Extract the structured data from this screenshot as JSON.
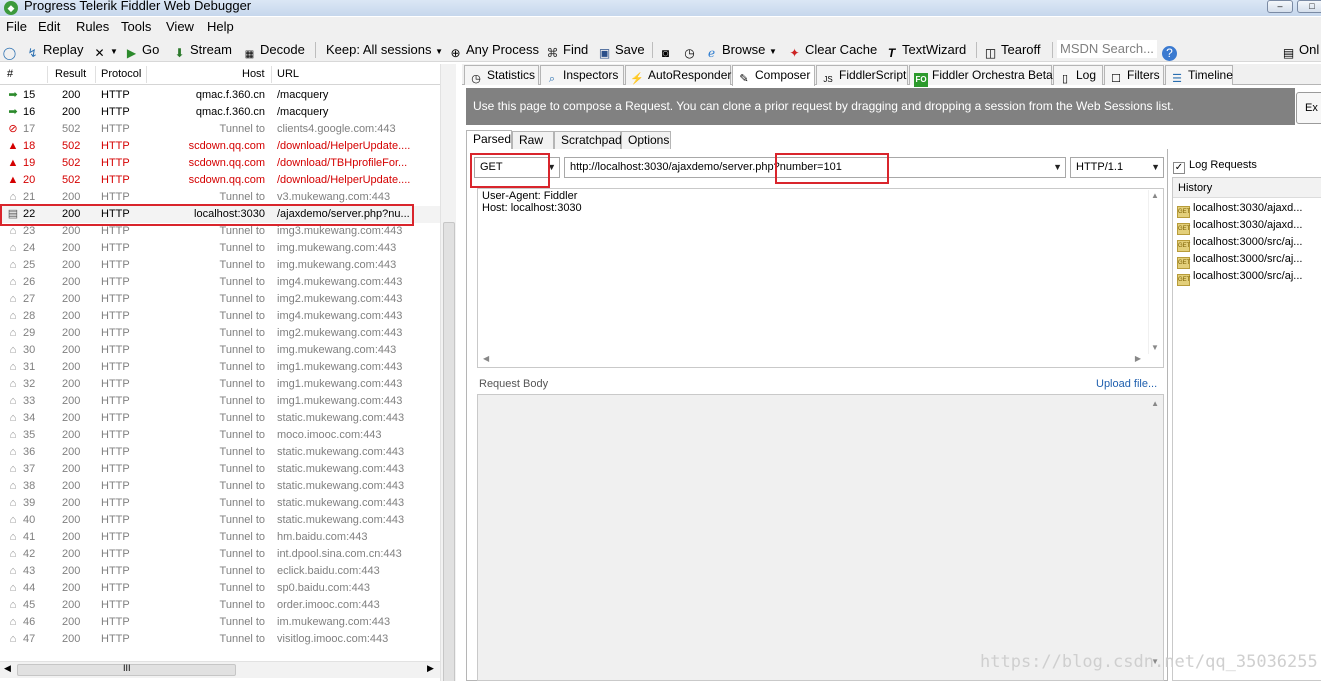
{
  "window": {
    "title": "Progress Telerik Fiddler Web Debugger"
  },
  "menu": [
    "File",
    "Edit",
    "Rules",
    "Tools",
    "View",
    "Help"
  ],
  "toolbar": {
    "replay": "Replay",
    "go": "Go",
    "stream": "Stream",
    "decode": "Decode",
    "keep": "Keep: All sessions",
    "any_process": "Any Process",
    "find": "Find",
    "save": "Save",
    "browse": "Browse",
    "clear_cache": "Clear Cache",
    "textwizard": "TextWizard",
    "tearoff": "Tearoff",
    "msdn_search": "MSDN Search...",
    "online": "Onl"
  },
  "sessions": {
    "columns": {
      "num": "#",
      "result": "Result",
      "protocol": "Protocol",
      "host": "Host",
      "url": "URL"
    },
    "rows": [
      {
        "num": "15",
        "result": "200",
        "protocol": "HTTP",
        "host": "qmac.f.360.cn",
        "url": "/macquery",
        "icon": "arrow-right-icon"
      },
      {
        "num": "16",
        "result": "200",
        "protocol": "HTTP",
        "host": "qmac.f.360.cn",
        "url": "/macquery",
        "icon": "arrow-right-icon"
      },
      {
        "num": "17",
        "result": "502",
        "protocol": "HTTP",
        "host": "Tunnel to",
        "url": "clients4.google.com:443",
        "icon": "blocked-icon"
      },
      {
        "num": "18",
        "result": "502",
        "protocol": "HTTP",
        "host": "scdown.qq.com",
        "url": "/download/HelperUpdate....",
        "icon": "warning-icon"
      },
      {
        "num": "19",
        "result": "502",
        "protocol": "HTTP",
        "host": "scdown.qq.com",
        "url": "/download/TBHprofileFor...",
        "icon": "warning-icon"
      },
      {
        "num": "20",
        "result": "502",
        "protocol": "HTTP",
        "host": "scdown.qq.com",
        "url": "/download/HelperUpdate....",
        "icon": "warning-icon"
      },
      {
        "num": "21",
        "result": "200",
        "protocol": "HTTP",
        "host": "Tunnel to",
        "url": "v3.mukewang.com:443",
        "icon": "lock-icon"
      },
      {
        "num": "22",
        "result": "200",
        "protocol": "HTTP",
        "host": "localhost:3030",
        "url": "/ajaxdemo/server.php?nu...",
        "icon": "document-icon"
      },
      {
        "num": "23",
        "result": "200",
        "protocol": "HTTP",
        "host": "Tunnel to",
        "url": "img3.mukewang.com:443",
        "icon": "lock-icon"
      },
      {
        "num": "24",
        "result": "200",
        "protocol": "HTTP",
        "host": "Tunnel to",
        "url": "img.mukewang.com:443",
        "icon": "lock-icon"
      },
      {
        "num": "25",
        "result": "200",
        "protocol": "HTTP",
        "host": "Tunnel to",
        "url": "img.mukewang.com:443",
        "icon": "lock-icon"
      },
      {
        "num": "26",
        "result": "200",
        "protocol": "HTTP",
        "host": "Tunnel to",
        "url": "img4.mukewang.com:443",
        "icon": "lock-icon"
      },
      {
        "num": "27",
        "result": "200",
        "protocol": "HTTP",
        "host": "Tunnel to",
        "url": "img2.mukewang.com:443",
        "icon": "lock-icon"
      },
      {
        "num": "28",
        "result": "200",
        "protocol": "HTTP",
        "host": "Tunnel to",
        "url": "img4.mukewang.com:443",
        "icon": "lock-icon"
      },
      {
        "num": "29",
        "result": "200",
        "protocol": "HTTP",
        "host": "Tunnel to",
        "url": "img2.mukewang.com:443",
        "icon": "lock-icon"
      },
      {
        "num": "30",
        "result": "200",
        "protocol": "HTTP",
        "host": "Tunnel to",
        "url": "img.mukewang.com:443",
        "icon": "lock-icon"
      },
      {
        "num": "31",
        "result": "200",
        "protocol": "HTTP",
        "host": "Tunnel to",
        "url": "img1.mukewang.com:443",
        "icon": "lock-icon"
      },
      {
        "num": "32",
        "result": "200",
        "protocol": "HTTP",
        "host": "Tunnel to",
        "url": "img1.mukewang.com:443",
        "icon": "lock-icon"
      },
      {
        "num": "33",
        "result": "200",
        "protocol": "HTTP",
        "host": "Tunnel to",
        "url": "img1.mukewang.com:443",
        "icon": "lock-icon"
      },
      {
        "num": "34",
        "result": "200",
        "protocol": "HTTP",
        "host": "Tunnel to",
        "url": "static.mukewang.com:443",
        "icon": "lock-icon"
      },
      {
        "num": "35",
        "result": "200",
        "protocol": "HTTP",
        "host": "Tunnel to",
        "url": "moco.imooc.com:443",
        "icon": "lock-icon"
      },
      {
        "num": "36",
        "result": "200",
        "protocol": "HTTP",
        "host": "Tunnel to",
        "url": "static.mukewang.com:443",
        "icon": "lock-icon"
      },
      {
        "num": "37",
        "result": "200",
        "protocol": "HTTP",
        "host": "Tunnel to",
        "url": "static.mukewang.com:443",
        "icon": "lock-icon"
      },
      {
        "num": "38",
        "result": "200",
        "protocol": "HTTP",
        "host": "Tunnel to",
        "url": "static.mukewang.com:443",
        "icon": "lock-icon"
      },
      {
        "num": "39",
        "result": "200",
        "protocol": "HTTP",
        "host": "Tunnel to",
        "url": "static.mukewang.com:443",
        "icon": "lock-icon"
      },
      {
        "num": "40",
        "result": "200",
        "protocol": "HTTP",
        "host": "Tunnel to",
        "url": "static.mukewang.com:443",
        "icon": "lock-icon"
      },
      {
        "num": "41",
        "result": "200",
        "protocol": "HTTP",
        "host": "Tunnel to",
        "url": "hm.baidu.com:443",
        "icon": "lock-icon"
      },
      {
        "num": "42",
        "result": "200",
        "protocol": "HTTP",
        "host": "Tunnel to",
        "url": "int.dpool.sina.com.cn:443",
        "icon": "lock-icon"
      },
      {
        "num": "43",
        "result": "200",
        "protocol": "HTTP",
        "host": "Tunnel to",
        "url": "eclick.baidu.com:443",
        "icon": "lock-icon"
      },
      {
        "num": "44",
        "result": "200",
        "protocol": "HTTP",
        "host": "Tunnel to",
        "url": "sp0.baidu.com:443",
        "icon": "lock-icon"
      },
      {
        "num": "45",
        "result": "200",
        "protocol": "HTTP",
        "host": "Tunnel to",
        "url": "order.imooc.com:443",
        "icon": "lock-icon"
      },
      {
        "num": "46",
        "result": "200",
        "protocol": "HTTP",
        "host": "Tunnel to",
        "url": "im.mukewang.com:443",
        "icon": "lock-icon"
      },
      {
        "num": "47",
        "result": "200",
        "protocol": "HTTP",
        "host": "Tunnel to",
        "url": "visitlog.imooc.com:443",
        "icon": "lock-icon"
      }
    ],
    "hscroll_grip": "III"
  },
  "tabs": [
    "Statistics",
    "Inspectors",
    "AutoResponder",
    "Composer",
    "FiddlerScript",
    "Fiddler Orchestra Beta",
    "Log",
    "Filters",
    "Timeline"
  ],
  "composer": {
    "banner": "Use this page to compose a Request. You can clone a prior request by dragging and dropping a session from the Web Sessions list.",
    "execute": "Ex",
    "subtabs": [
      "Parsed",
      "Raw",
      "Scratchpad",
      "Options"
    ],
    "method": "GET",
    "url": "http://localhost:3030/ajaxdemo/server.php?number=101",
    "http_version": "HTTP/1.1",
    "headers": [
      "User-Agent: Fiddler",
      "Host: localhost:3030"
    ],
    "request_body_label": "Request Body",
    "upload_file": "Upload file...",
    "log_requests": "Log Requests",
    "history_label": "History",
    "history": [
      "localhost:3030/ajaxd...",
      "localhost:3030/ajaxd...",
      "localhost:3000/src/aj...",
      "localhost:3000/src/aj...",
      "localhost:3000/src/aj..."
    ]
  },
  "colors": {
    "highlight": "#d9252c",
    "error_red": "#d40000",
    "banner_gray": "#818181"
  },
  "watermark": "https://blog.csdn.net/qq_35036255"
}
